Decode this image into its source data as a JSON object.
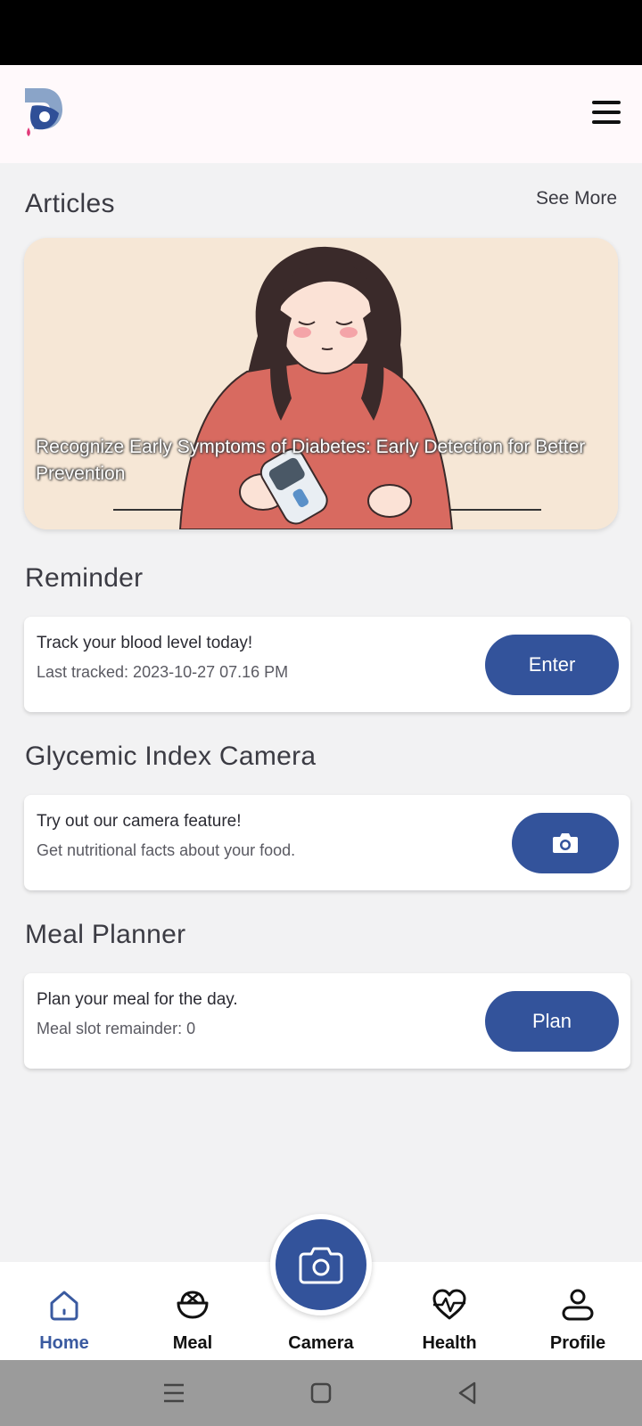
{
  "header": {
    "logo_icon": "app-logo-d-drop",
    "menu_icon": "hamburger-menu-icon"
  },
  "articles": {
    "title": "Articles",
    "see_more": "See More",
    "featured_title": "Recognize Early Symptoms of Diabetes: Early Detection for Better Prevention"
  },
  "reminder": {
    "title": "Reminder",
    "line1": "Track your blood level today!",
    "line2": "Last tracked: 2023-10-27 07.16 PM",
    "button": "Enter"
  },
  "glycemic": {
    "title": "Glycemic Index Camera",
    "line1": "Try out our camera feature!",
    "line2": "Get nutritional facts about your food.",
    "button_icon": "camera-icon"
  },
  "meal_planner": {
    "title": "Meal Planner",
    "line1": "Plan your meal for the day.",
    "line2": "Meal slot remainder: 0",
    "button": "Plan"
  },
  "bottom_nav": {
    "items": [
      {
        "label": "Home",
        "icon": "home-icon",
        "active": true
      },
      {
        "label": "Meal",
        "icon": "bowl-icon",
        "active": false
      },
      {
        "label": "Camera",
        "icon": "camera-icon",
        "active": false
      },
      {
        "label": "Health",
        "icon": "heart-pulse-icon",
        "active": false
      },
      {
        "label": "Profile",
        "icon": "person-icon",
        "active": false
      }
    ]
  },
  "colors": {
    "primary": "#33539b",
    "active_nav": "#3a5aa0",
    "background": "#f2f2f3",
    "header_bg": "#fff9fb"
  }
}
